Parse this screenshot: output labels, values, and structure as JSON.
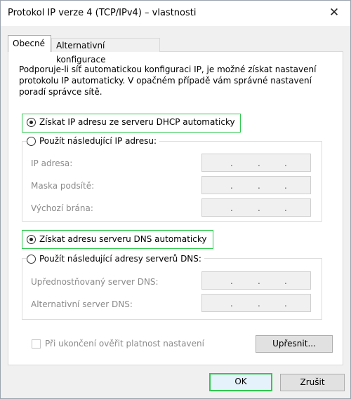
{
  "window": {
    "title": "Protokol IP verze 4 (TCP/IPv4) – vlastnosti",
    "close_glyph": "✕"
  },
  "tabs": [
    {
      "label": "Obecné",
      "active": true
    },
    {
      "label": "Alternativní konfigurace",
      "active": false
    }
  ],
  "description": "Podporuje-li síť automatickou konfiguraci IP, je možné získat nastavení protokolu IP automaticky. V opačném případě vám správné nastavení poradí správce sítě.",
  "ip_section": {
    "auto_option": {
      "label": "Získat IP adresu ze serveru DHCP automaticky",
      "checked": true
    },
    "manual_option": {
      "label": "Použít následující IP adresu:",
      "checked": false
    },
    "fields": [
      {
        "label": "IP adresa:",
        "value": ". . ."
      },
      {
        "label": "Maska podsítě:",
        "value": ". . ."
      },
      {
        "label": "Výchozí brána:",
        "value": ". . ."
      }
    ]
  },
  "dns_section": {
    "auto_option": {
      "label": "Získat adresu serveru DNS automaticky",
      "checked": true
    },
    "manual_option": {
      "label": "Použít následující adresy serverů DNS:",
      "checked": false
    },
    "fields": [
      {
        "label": "Upřednostňovaný server DNS:",
        "value": ". . ."
      },
      {
        "label": "Alternativní server DNS:",
        "value": ". . ."
      }
    ]
  },
  "validate_checkbox": {
    "label": "Při ukončení ověřit platnost nastavení",
    "checked": false,
    "enabled": false
  },
  "buttons": {
    "advanced": "Upřesnit...",
    "ok": "OK",
    "cancel": "Zrušit"
  },
  "colors": {
    "focus_accent": "#30c94e",
    "panel_bg": "#ffffff",
    "dialog_bg": "#f0f0f0",
    "disabled_text": "#8a8a8a"
  }
}
